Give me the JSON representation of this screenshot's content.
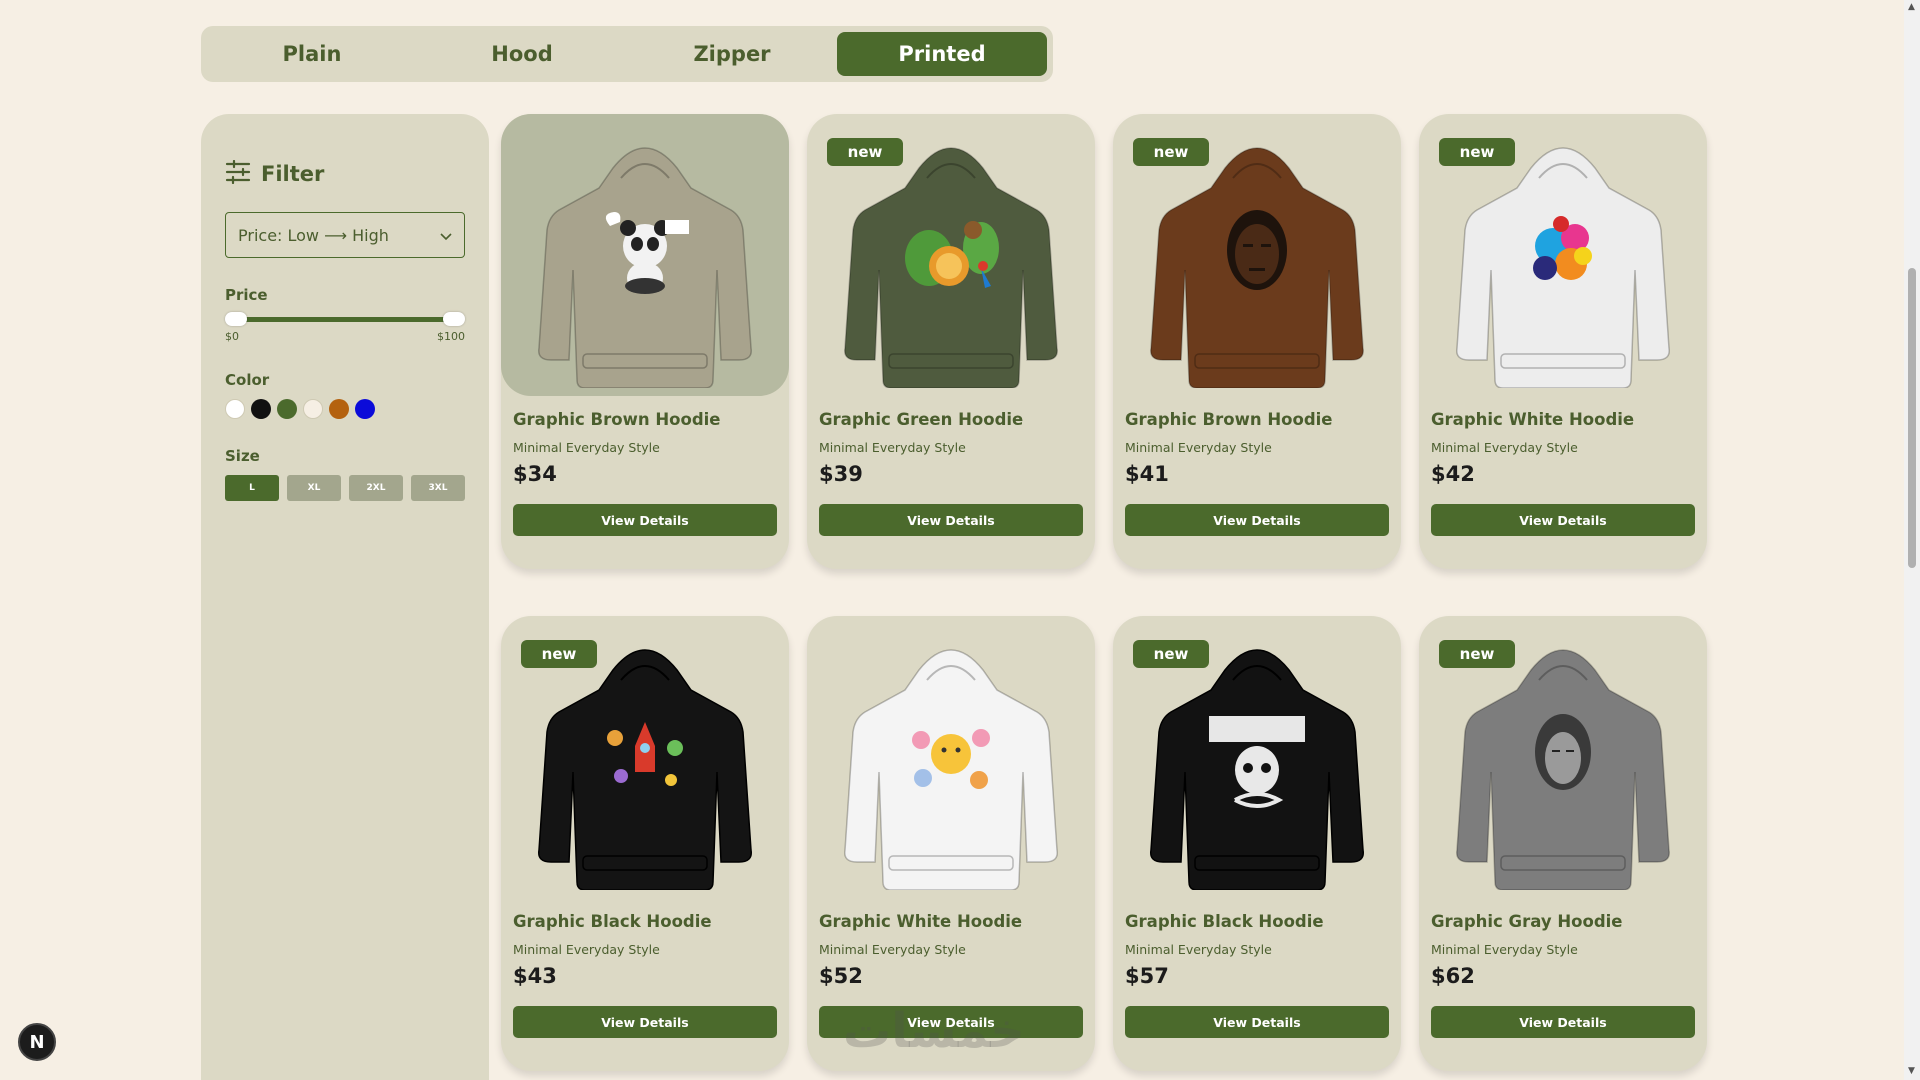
{
  "tabs": [
    {
      "label": "Plain",
      "active": false
    },
    {
      "label": "Hood",
      "active": false
    },
    {
      "label": "Zipper",
      "active": false
    },
    {
      "label": "Printed",
      "active": true
    }
  ],
  "sidebar": {
    "title": "Filter",
    "sort_value": "Price: Low ⟶ High",
    "price_label": "Price",
    "price_min": "$0",
    "price_max": "$100",
    "price_range_selected": [
      0,
      100
    ],
    "color_label": "Color",
    "colors": [
      "#ffffff",
      "#111111",
      "#4b6a2c",
      "#f6efe4",
      "#b4620f",
      "#0b0bd9"
    ],
    "size_label": "Size",
    "sizes": [
      "L",
      "XL",
      "2XL",
      "3XL"
    ],
    "selected_size": "L"
  },
  "products": [
    {
      "title": "Graphic Brown Hoodie",
      "subtitle": "Minimal Everyday Style",
      "price": "$34",
      "badge": "",
      "button": "View Details",
      "hoodie_color": "#a8a38d",
      "print": "panda"
    },
    {
      "title": "Graphic Green Hoodie",
      "subtitle": "Minimal Everyday Style",
      "price": "$39",
      "badge": "new",
      "button": "View Details",
      "hoodie_color": "#4f5b3e",
      "print": "jungle"
    },
    {
      "title": "Graphic Brown Hoodie",
      "subtitle": "Minimal Everyday Style",
      "price": "$41",
      "badge": "new",
      "button": "View Details",
      "hoodie_color": "#6b3b1c",
      "print": "face"
    },
    {
      "title": "Graphic White Hoodie",
      "subtitle": "Minimal Everyday Style",
      "price": "$42",
      "badge": "new",
      "button": "View Details",
      "hoodie_color": "#ededed",
      "print": "splash"
    },
    {
      "title": "Graphic Black Hoodie",
      "subtitle": "Minimal Everyday Style",
      "price": "$43",
      "badge": "new",
      "button": "View Details",
      "hoodie_color": "#141414",
      "print": "rocket"
    },
    {
      "title": "Graphic White Hoodie",
      "subtitle": "Minimal Everyday Style",
      "price": "$52",
      "badge": "",
      "button": "View Details",
      "hoodie_color": "#f4f4f4",
      "print": "flowers"
    },
    {
      "title": "Graphic Black Hoodie",
      "subtitle": "Minimal Everyday Style",
      "price": "$57",
      "badge": "new",
      "button": "View Details",
      "hoodie_color": "#121212",
      "print": "skull"
    },
    {
      "title": "Graphic Gray Hoodie",
      "subtitle": "Minimal Everyday Style",
      "price": "$62",
      "badge": "new",
      "button": "View Details",
      "hoodie_color": "#7d7d7d",
      "print": "portrait"
    }
  ],
  "misc": {
    "dev_badge": "N",
    "watermark": "خمسات"
  }
}
